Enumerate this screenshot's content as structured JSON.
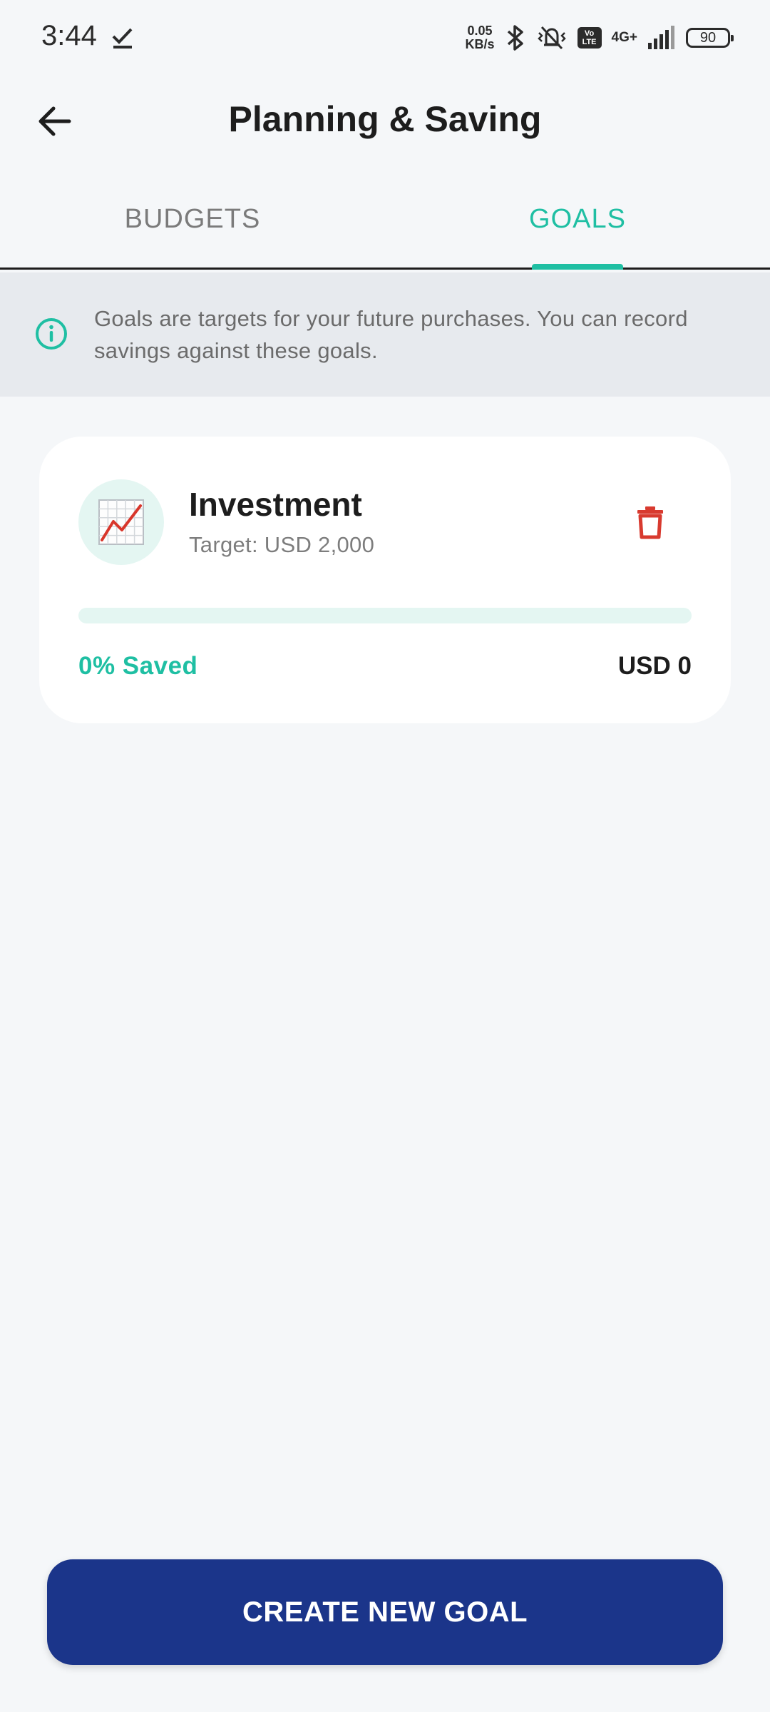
{
  "status_bar": {
    "time": "3:44",
    "net_speed_value": "0.05",
    "net_speed_unit": "KB/s",
    "volte_top": "Vo",
    "volte_bottom": "LTE",
    "network_type": "4G+",
    "battery": "90"
  },
  "header": {
    "title": "Planning & Saving",
    "back_icon": "arrow-left-icon"
  },
  "tabs": [
    {
      "label": "BUDGETS",
      "active": false
    },
    {
      "label": "GOALS",
      "active": true
    }
  ],
  "info": {
    "icon": "info-circle-icon",
    "text": "Goals are targets for your future purchases. You can record savings against these goals."
  },
  "goals": [
    {
      "name": "Investment",
      "icon": "chart-increasing-icon",
      "target_label": "Target: USD 2,000",
      "progress": 0,
      "saved_label": "0% Saved",
      "saved_amount": "USD 0",
      "delete_icon": "trash-icon"
    }
  ],
  "actions": {
    "create_goal_label": "CREATE NEW GOAL"
  },
  "colors": {
    "accent": "#1fbfa3",
    "primary_button": "#1b358a",
    "delete": "#d83a2f",
    "background": "#f5f7f9",
    "banner": "#e7eaee"
  }
}
